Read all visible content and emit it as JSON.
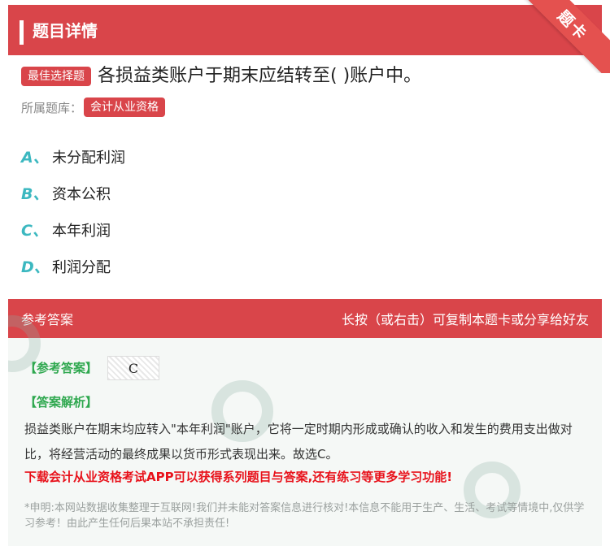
{
  "header": {
    "title": "题目详情",
    "corner_badge": "题卡"
  },
  "question": {
    "type_tag": "最佳选择题",
    "text": "各损益类账户于期末应结转至( )账户中。",
    "bank_label": "所属题库：",
    "bank_name": "会计从业资格"
  },
  "options": [
    {
      "letter": "A、",
      "text": "未分配利润"
    },
    {
      "letter": "B、",
      "text": "资本公积"
    },
    {
      "letter": "C、",
      "text": "本年利润"
    },
    {
      "letter": "D、",
      "text": "利润分配"
    }
  ],
  "answer": {
    "section_title": "参考答案",
    "share_hint": "长按（或右击）可复制本题卡或分享给好友",
    "answer_label": "【参考答案】",
    "answer_value": "C",
    "explanation_label": "【答案解析】",
    "explanation": "损益类账户在期末均应转入\"本年利润\"账户，它将一定时期内形成或确认的收入和发生的费用支出做对比，将经营活动的最终成果以货币形式表现出来。故选C。",
    "promo": "下载会计从业资格考试APP可以获得系列题目与答案,还有练习等更多学习功能!",
    "disclaimer": "*申明:本网站数据收集整理于互联网!我们并未能对答案信息进行核对!本信息不能用于生产、生活、考试等情境中,仅供学习参考！由此产生任何后果本站不承担责任!"
  },
  "colors": {
    "brand_red": "#d9454a",
    "option_letter": "#3cb8c0",
    "answer_green": "#2fa84f",
    "promo_red": "#e8121b"
  }
}
